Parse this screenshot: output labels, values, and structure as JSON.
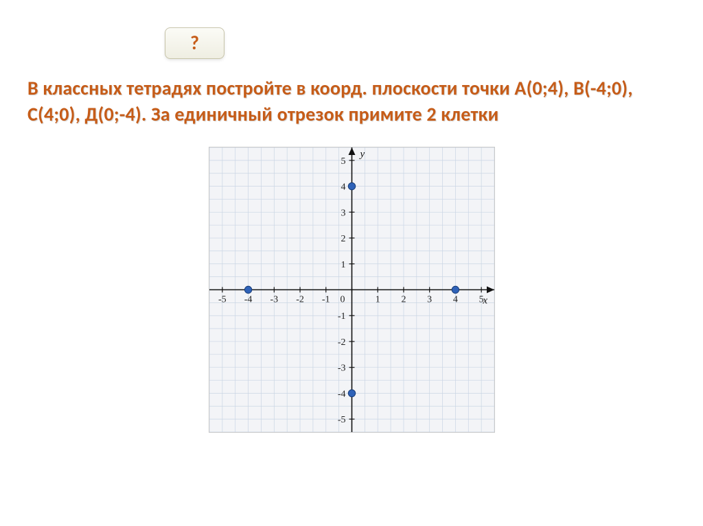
{
  "help": {
    "label": "?"
  },
  "problem": {
    "line1": "В классных тетрадях постройте в коорд. плоскости точки А(0;4), В(-4;0),",
    "line2": "С(4;0), Д(0;-4). За единичный отрезок примите 2 клетки"
  },
  "chart_data": {
    "type": "scatter",
    "title": "",
    "xlabel": "x",
    "ylabel": "y",
    "xlim": [
      -5.5,
      5.5
    ],
    "ylim": [
      -5.5,
      5.5
    ],
    "x_ticks": [
      -5,
      -4,
      -3,
      -2,
      -1,
      0,
      1,
      2,
      3,
      4,
      5
    ],
    "y_ticks": [
      -5,
      -4,
      -3,
      -2,
      -1,
      1,
      2,
      3,
      4,
      5
    ],
    "series": [
      {
        "name": "points",
        "values": [
          {
            "x": 0,
            "y": 4
          },
          {
            "x": -4,
            "y": 0
          },
          {
            "x": 4,
            "y": 0
          },
          {
            "x": 0,
            "y": -4
          }
        ]
      }
    ]
  }
}
